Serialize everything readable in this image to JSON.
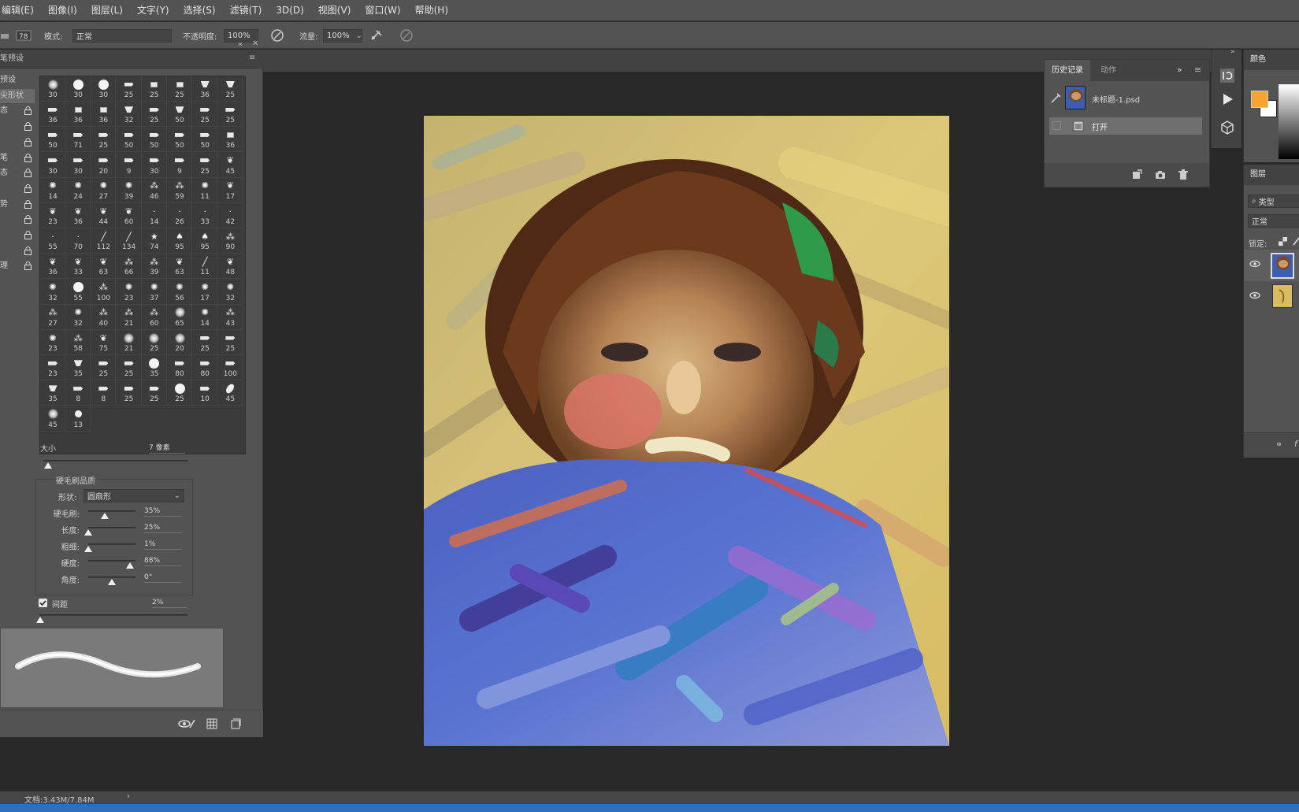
{
  "menu": [
    "编辑(E)",
    "图像(I)",
    "图层(L)",
    "文字(Y)",
    "选择(S)",
    "滤镜(T)",
    "3D(D)",
    "视图(V)",
    "窗口(W)",
    "帮助(H)"
  ],
  "options": {
    "mode_label": "模式:",
    "mode_value": "正常",
    "opacity_label": "不透明度:",
    "opacity_value": "100%",
    "flow_label": "流量:",
    "flow_value": "100%"
  },
  "brush_panel": {
    "title": "笔预设",
    "side_items": [
      "预设",
      "尖形状",
      "态",
      "",
      "",
      "笔",
      "态",
      "",
      "势",
      "",
      "",
      "",
      "理"
    ],
    "tips": [
      {
        "g": "soft",
        "n": "30"
      },
      {
        "g": "hard",
        "n": "30"
      },
      {
        "g": "hard",
        "n": "30"
      },
      {
        "g": "flat",
        "n": "25"
      },
      {
        "g": "sq",
        "n": "25"
      },
      {
        "g": "sq",
        "n": "25"
      },
      {
        "g": "fan",
        "n": "36"
      },
      {
        "g": "fan",
        "n": "25"
      },
      {
        "g": "flat",
        "n": "36"
      },
      {
        "g": "sq",
        "n": "36"
      },
      {
        "g": "sq",
        "n": "36"
      },
      {
        "g": "fan",
        "n": "32"
      },
      {
        "g": "flat",
        "n": "25"
      },
      {
        "g": "fan",
        "n": "50"
      },
      {
        "g": "flat",
        "n": "25"
      },
      {
        "g": "flat",
        "n": "25"
      },
      {
        "g": "flat",
        "n": "50"
      },
      {
        "g": "flat",
        "n": "71"
      },
      {
        "g": "flat",
        "n": "25"
      },
      {
        "g": "flat",
        "n": "50"
      },
      {
        "g": "flat",
        "n": "50"
      },
      {
        "g": "flat",
        "n": "50"
      },
      {
        "g": "flat",
        "n": "50"
      },
      {
        "g": "sq",
        "n": "36"
      },
      {
        "g": "flat",
        "n": "30"
      },
      {
        "g": "flat",
        "n": "30"
      },
      {
        "g": "flat",
        "n": "20"
      },
      {
        "g": "flat",
        "n": "9"
      },
      {
        "g": "flat",
        "n": "30"
      },
      {
        "g": "flat",
        "n": "9"
      },
      {
        "g": "flat",
        "n": "25"
      },
      {
        "g": "leaf",
        "n": "45"
      },
      {
        "g": "splat",
        "n": "14"
      },
      {
        "g": "splat",
        "n": "24"
      },
      {
        "g": "splat",
        "n": "27"
      },
      {
        "g": "splat",
        "n": "39"
      },
      {
        "g": "spray",
        "n": "46"
      },
      {
        "g": "spray",
        "n": "59"
      },
      {
        "g": "splat",
        "n": "11"
      },
      {
        "g": "leaf",
        "n": "17"
      },
      {
        "g": "leaf",
        "n": "23"
      },
      {
        "g": "leaf",
        "n": "36"
      },
      {
        "g": "leaf",
        "n": "44"
      },
      {
        "g": "leaf",
        "n": "60"
      },
      {
        "g": "dot",
        "n": "14"
      },
      {
        "g": "dot",
        "n": "26"
      },
      {
        "g": "dot",
        "n": "33"
      },
      {
        "g": "dot",
        "n": "42"
      },
      {
        "g": "dot",
        "n": "55"
      },
      {
        "g": "dot",
        "n": "70"
      },
      {
        "g": "stroke",
        "n": "112"
      },
      {
        "g": "stroke",
        "n": "134"
      },
      {
        "g": "star",
        "n": "74"
      },
      {
        "g": "drop",
        "n": "95"
      },
      {
        "g": "drop",
        "n": "95"
      },
      {
        "g": "spray",
        "n": "90"
      },
      {
        "g": "leaf",
        "n": "36"
      },
      {
        "g": "leaf",
        "n": "33"
      },
      {
        "g": "leaf",
        "n": "63"
      },
      {
        "g": "spray",
        "n": "66"
      },
      {
        "g": "spray",
        "n": "39"
      },
      {
        "g": "leaf",
        "n": "63"
      },
      {
        "g": "stroke",
        "n": "11"
      },
      {
        "g": "leaf",
        "n": "48"
      },
      {
        "g": "splat",
        "n": "32"
      },
      {
        "g": "hard",
        "n": "55"
      },
      {
        "g": "spray",
        "n": "100"
      },
      {
        "g": "splat",
        "n": "23"
      },
      {
        "g": "splat",
        "n": "37"
      },
      {
        "g": "splat",
        "n": "56"
      },
      {
        "g": "splat",
        "n": "17"
      },
      {
        "g": "splat",
        "n": "32"
      },
      {
        "g": "spray",
        "n": "27"
      },
      {
        "g": "splat",
        "n": "32"
      },
      {
        "g": "spray",
        "n": "40"
      },
      {
        "g": "spray",
        "n": "21"
      },
      {
        "g": "spray",
        "n": "60"
      },
      {
        "g": "soft",
        "n": "65"
      },
      {
        "g": "splat",
        "n": "14"
      },
      {
        "g": "spray",
        "n": "43"
      },
      {
        "g": "splat",
        "n": "23"
      },
      {
        "g": "spray",
        "n": "58"
      },
      {
        "g": "leaf",
        "n": "75"
      },
      {
        "g": "soft",
        "n": "21"
      },
      {
        "g": "soft",
        "n": "25"
      },
      {
        "g": "soft",
        "n": "20"
      },
      {
        "g": "flat",
        "n": "25"
      },
      {
        "g": "flat",
        "n": "25"
      },
      {
        "g": "flat",
        "n": "23"
      },
      {
        "g": "fan",
        "n": "35"
      },
      {
        "g": "flat",
        "n": "25"
      },
      {
        "g": "flat",
        "n": "25"
      },
      {
        "g": "hard",
        "n": "35"
      },
      {
        "g": "flat",
        "n": "80"
      },
      {
        "g": "flat",
        "n": "80"
      },
      {
        "g": "flat",
        "n": "100"
      },
      {
        "g": "fan",
        "n": "35"
      },
      {
        "g": "flat",
        "n": "8"
      },
      {
        "g": "flat",
        "n": "8"
      },
      {
        "g": "flat",
        "n": "25"
      },
      {
        "g": "flat",
        "n": "25"
      },
      {
        "g": "hard",
        "n": "25"
      },
      {
        "g": "flat",
        "n": "10"
      },
      {
        "g": "oval",
        "n": "45"
      },
      {
        "g": "soft",
        "n": "45"
      },
      {
        "g": "hard-sm",
        "n": "13"
      }
    ],
    "size_label": "大小",
    "size_value": "7 像素",
    "bristle_title": "硬毛刷品质",
    "shape_label": "形状:",
    "shape_value": "圆扇形",
    "bristle_rows": [
      {
        "label": "硬毛刷:",
        "value": "35%",
        "level": 0.35
      },
      {
        "label": "长度:",
        "value": "25%",
        "level": 0.0
      },
      {
        "label": "粗细:",
        "value": "1%",
        "level": 0.0
      },
      {
        "label": "硬度:",
        "value": "88%",
        "level": 0.88
      },
      {
        "label": "角度:",
        "value": "0°",
        "level": 0.5
      }
    ],
    "spacing_label": "间距",
    "spacing_value": "2%"
  },
  "history": {
    "tab_active": "历史记录",
    "tab_inactive": "动作",
    "snapshot_name": "未标题-1.psd",
    "step_open": "打开"
  },
  "color_panel": {
    "title": "颜色",
    "foreground": "#f4a431",
    "background": "#ffffff"
  },
  "layers_panel": {
    "title": "图层",
    "filter_label": "类型",
    "blend_mode": "正常",
    "lock_label": "锁定:"
  },
  "status": {
    "doc_size": "文档:3.43M/7.84M"
  },
  "colors": {
    "panel": "#535353",
    "panel_dark": "#424242",
    "workspace": "#282828",
    "accent_blue": "#2c6fbe"
  }
}
